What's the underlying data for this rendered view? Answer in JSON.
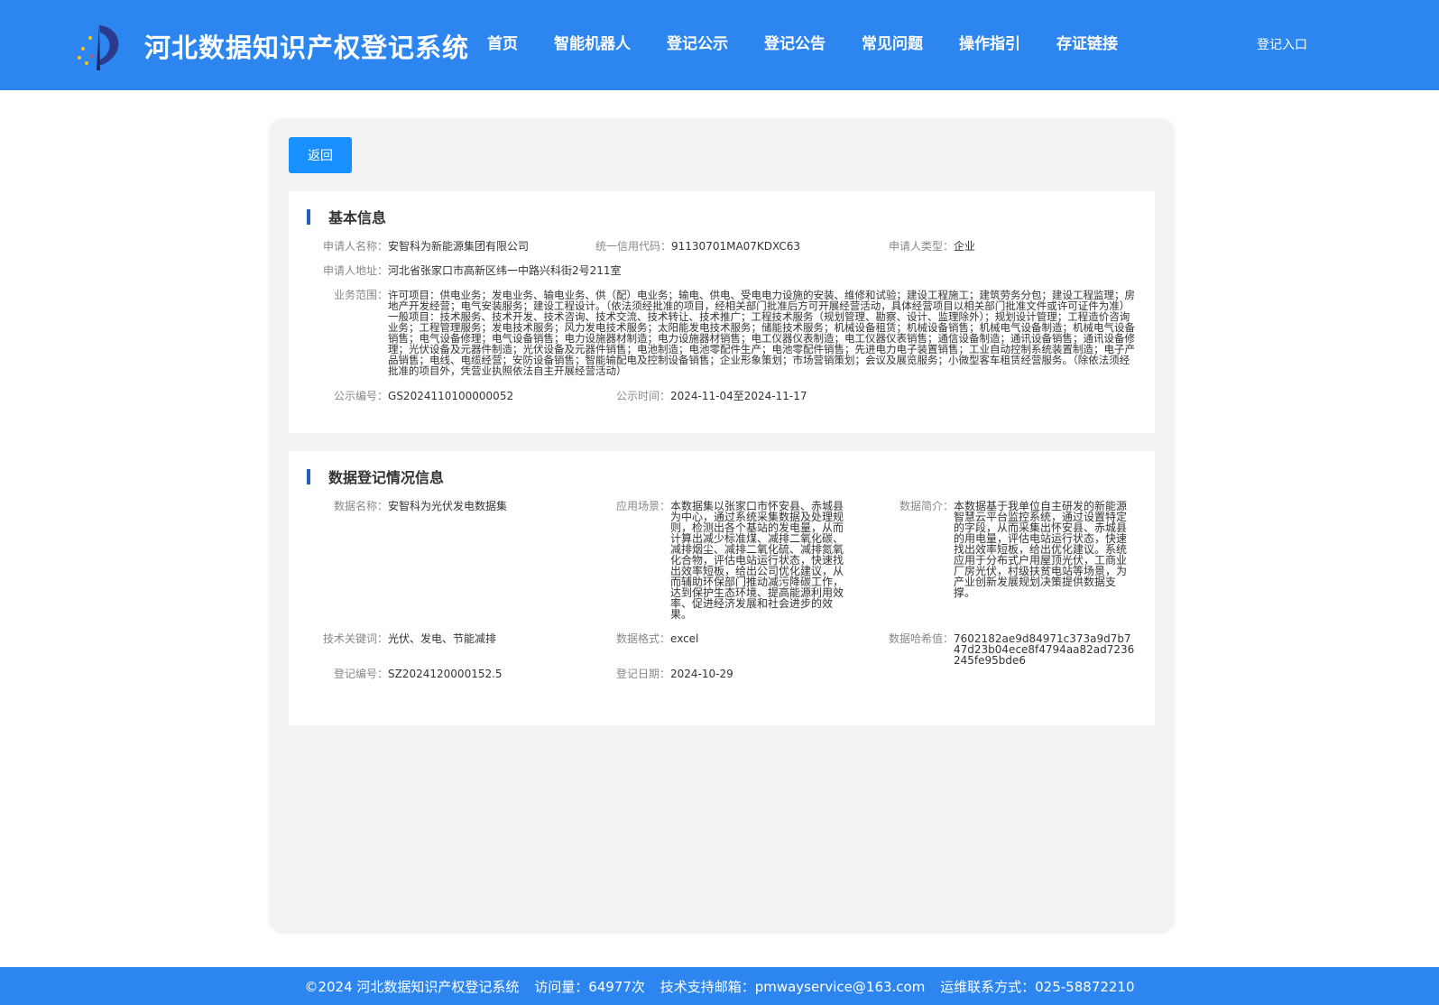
{
  "header": {
    "site_title": "河北数据知识产权登记系统",
    "nav": [
      "首页",
      "智能机器人",
      "登记公示",
      "登记公告",
      "常见问题",
      "操作指引",
      "存证链接"
    ],
    "login_label": "登记入口"
  },
  "main": {
    "back_label": "返回",
    "basic": {
      "title": "基本信息",
      "applicant_name_label": "申请人名称：",
      "applicant_name": "安智科为新能源集团有限公司",
      "credit_code_label": "统一信用代码：",
      "credit_code": "91130701MA07KDXC63",
      "applicant_type_label": "申请人类型：",
      "applicant_type": "企业",
      "address_label": "申请人地址：",
      "address": "河北省张家口市高新区纬一中路兴科街2号211室",
      "scope_label": "业务范围：",
      "scope": "许可项目：供电业务；发电业务、输电业务、供（配）电业务；输电、供电、受电电力设施的安装、维修和试验；建设工程施工；建筑劳务分包；建设工程监理；房地产开发经营；电气安装服务；建设工程设计。（依法须经批准的项目，经相关部门批准后方可开展经营活动，具体经营项目以相关部门批准文件或许可证件为准）一般项目：技术服务、技术开发、技术咨询、技术交流、技术转让、技术推广；工程技术服务（规划管理、勘察、设计、监理除外）；规划设计管理；工程造价咨询业务；工程管理服务；发电技术服务；风力发电技术服务；太阳能发电技术服务；储能技术服务；机械设备租赁；机械设备销售；机械电气设备制造；机械电气设备销售；电气设备修理；电气设备销售；电力设施器材制造；电力设施器材销售；电工仪器仪表制造；电工仪器仪表销售；通信设备制造；通讯设备销售；通讯设备修理；光伏设备及元器件制造；光伏设备及元器件销售；电池制造；电池零配件生产；电池零配件销售；先进电力电子装置销售；工业自动控制系统装置制造；电子产品销售；电线、电缆经营；安防设备销售；智能输配电及控制设备销售；企业形象策划；市场营销策划；会议及展览服务；小微型客车租赁经营服务。（除依法须经批准的项目外，凭营业执照依法自主开展经营活动）",
      "notice_no_label": "公示编号：",
      "notice_no": "GS2024110100000052",
      "notice_time_label": "公示时间：",
      "notice_time": "2024-11-04至2024-11-17"
    },
    "registration": {
      "title": "数据登记情况信息",
      "data_name_label": "数据名称：",
      "data_name": "安智科为光伏发电数据集",
      "scenario_label": "应用场景：",
      "scenario": "本数据集以张家口市怀安县、赤城县为中心，通过系统采集数据及处理规则，检测出各个基站的发电量，从而计算出减少标准煤、减排二氧化碳、减排烟尘、减排二氧化硫、减排氮氧化合物，评估电站运行状态，快速找出效率短板，给出公司优化建议，从而辅助环保部门推动减污降碳工作，达到保护生态环境、提高能源利用效率、促进经济发展和社会进步的效果。",
      "intro_label": "数据简介：",
      "intro": "本数据基于我单位自主研发的新能源智慧云平台监控系统，通过设置特定的字段，从而采集出怀安县、赤城县的用电量，评估电站运行状态，快速找出效率短板，给出优化建议。系统应用于分布式户用屋顶光伏，工商业厂房光伏，村级扶贫电站等场景，为产业创新发展规划决策提供数据支撑。",
      "keywords_label": "技术关键词：",
      "keywords": "光伏、发电、节能减排",
      "format_label": "数据格式：",
      "format": "excel",
      "hash_label": "数据哈希值：",
      "hash": "7602182ae9d84971c373a9d7b747d23b04ece8f4794aa82ad7236245fe95bde6",
      "reg_no_label": "登记编号：",
      "reg_no": "SZ2024120000152.5",
      "reg_date_label": "登记日期：",
      "reg_date": "2024-10-29"
    }
  },
  "footer": {
    "copyright": "©2024 河北数据知识产权登记系统",
    "visits": "访问量：64977次",
    "email": "技术支持邮箱：pmwayservice@163.com",
    "phone": "运维联系方式：025-58872210"
  },
  "colors": {
    "header_bg": "#2d86f0",
    "button_bg": "#1890ff",
    "title_bar": "#1f5fb8"
  }
}
